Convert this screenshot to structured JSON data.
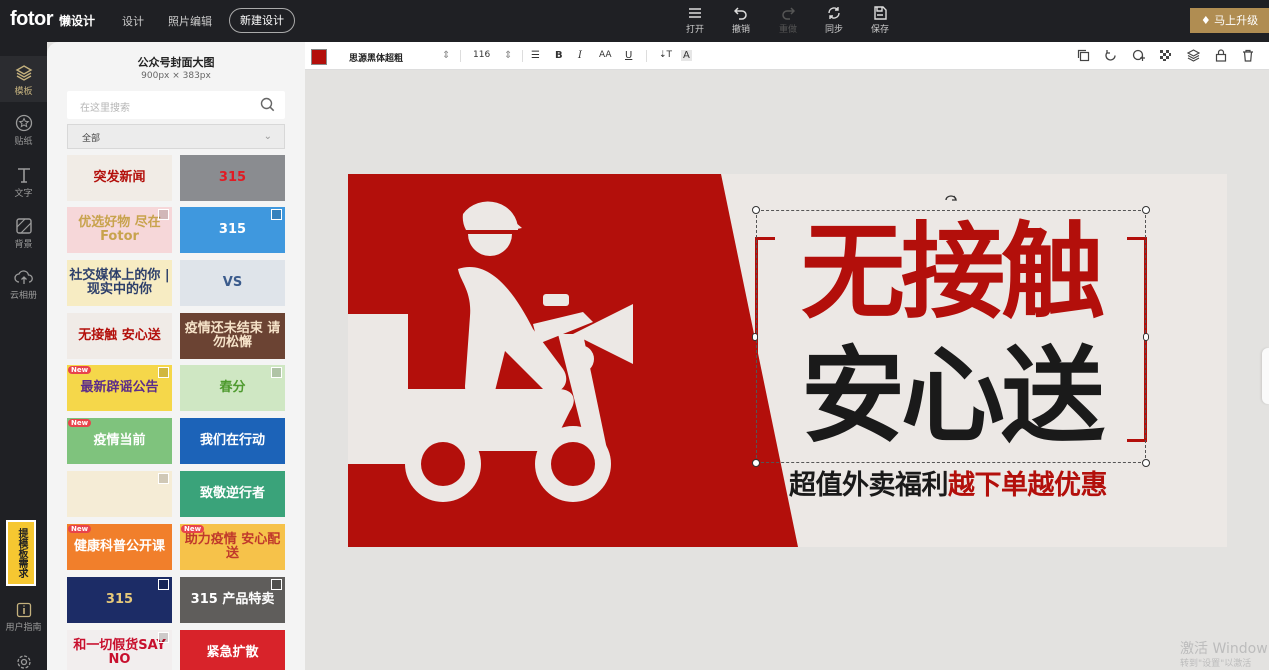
{
  "header": {
    "logo": "fotor",
    "logo_sub": "懒设计",
    "nav": [
      "设计",
      "照片编辑"
    ],
    "new_design": "新建设计",
    "actions": [
      {
        "label": "打开",
        "icon": "menu-icon",
        "enabled": true
      },
      {
        "label": "撤销",
        "icon": "undo-icon",
        "enabled": true
      },
      {
        "label": "重做",
        "icon": "redo-icon",
        "enabled": false
      },
      {
        "label": "同步",
        "icon": "sync-icon",
        "enabled": true
      },
      {
        "label": "保存",
        "icon": "save-icon",
        "enabled": true
      }
    ],
    "upgrade": "马上升级"
  },
  "rail": {
    "items": [
      {
        "label": "模板",
        "icon": "layers-icon",
        "active": true
      },
      {
        "label": "贴纸",
        "icon": "star-icon",
        "active": false
      },
      {
        "label": "文字",
        "icon": "text-icon",
        "active": false
      },
      {
        "label": "背景",
        "icon": "background-icon",
        "active": false
      },
      {
        "label": "云相册",
        "icon": "cloud-upload-icon",
        "active": false
      }
    ],
    "request": "提模板需求",
    "guide": "用户指南"
  },
  "panel": {
    "title": "公众号封面大图",
    "size": "900px × 383px",
    "search_placeholder": "在这里搜索",
    "filter_value": "全部",
    "templates": [
      {
        "text": "突发新闻",
        "bg": "#f1ece6",
        "fg": "#b30f0b",
        "badge": "",
        "fav": false
      },
      {
        "text": "315",
        "bg": "#8a8c90",
        "fg": "#e21b23",
        "badge": "",
        "fav": false
      },
      {
        "text": "优选好物 尽在Fotor",
        "bg": "#f6d7d9",
        "fg": "#c8a34d",
        "badge": "",
        "fav": true
      },
      {
        "text": "315",
        "bg": "#3f98de",
        "fg": "#ffffff",
        "badge": "",
        "fav": true
      },
      {
        "text": "社交媒体上的你 | 现实中的你",
        "bg": "#f7ecc3",
        "fg": "#2c3e6a",
        "badge": "",
        "fav": false
      },
      {
        "text": "VS",
        "bg": "#dfe4ea",
        "fg": "#3b5b8c",
        "badge": "",
        "fav": false
      },
      {
        "text": "无接触 安心送",
        "bg": "#f0ebe7",
        "fg": "#b30f0b",
        "badge": "",
        "fav": false
      },
      {
        "text": "疫情还未结束 请勿松懈",
        "bg": "#6b4333",
        "fg": "#f5e2c8",
        "badge": "",
        "fav": false
      },
      {
        "text": "最新辟谣公告",
        "bg": "#f5d74a",
        "fg": "#5b2c8a",
        "badge": "New",
        "fav": true
      },
      {
        "text": "春分",
        "bg": "#cfe7c3",
        "fg": "#4e9a2e",
        "badge": "",
        "fav": true
      },
      {
        "text": "疫情当前",
        "bg": "#7fc37d",
        "fg": "#ffffff",
        "badge": "New",
        "fav": false
      },
      {
        "text": "我们在行动",
        "bg": "#1c63b8",
        "fg": "#ffffff",
        "badge": "",
        "fav": false
      },
      {
        "text": "",
        "bg": "#f5ecd6",
        "fg": "#555555",
        "badge": "",
        "fav": true
      },
      {
        "text": "致敬逆行者",
        "bg": "#3aa37a",
        "fg": "#ffffff",
        "badge": "",
        "fav": false
      },
      {
        "text": "健康科普公开课",
        "bg": "#f17f2b",
        "fg": "#ffffff",
        "badge": "New",
        "fav": false
      },
      {
        "text": "助力疫情 安心配送",
        "bg": "#f6c24a",
        "fg": "#c0392b",
        "badge": "New",
        "fav": false
      },
      {
        "text": "315",
        "bg": "#1c2c66",
        "fg": "#e7c97a",
        "badge": "",
        "fav": true
      },
      {
        "text": "315 产品特卖",
        "bg": "#5f5d5b",
        "fg": "#ffffff",
        "badge": "",
        "fav": true
      },
      {
        "text": "和一切假货SAY NO",
        "bg": "#f2eeee",
        "fg": "#c8102e",
        "badge": "",
        "fav": true
      },
      {
        "text": "紧急扩散",
        "bg": "#d8232a",
        "fg": "#ffffff",
        "badge": "",
        "fav": false
      }
    ]
  },
  "format_bar": {
    "color": "#b30f0b",
    "font": "思源黑体超粗",
    "size": "116",
    "items": [
      "B",
      "I",
      "AA",
      "U",
      "A"
    ]
  },
  "canvas": {
    "headline1": "无接触",
    "headline2": "安心送",
    "sub_black": "超值外卖福利",
    "sub_red": "越下单越优惠",
    "colors": {
      "red": "#b30f0b",
      "bg": "#ece8e5",
      "dark": "#1a1a1a"
    }
  },
  "watermark": {
    "line1": "激活 Window",
    "line2": "转到\"设置\"以激活"
  }
}
